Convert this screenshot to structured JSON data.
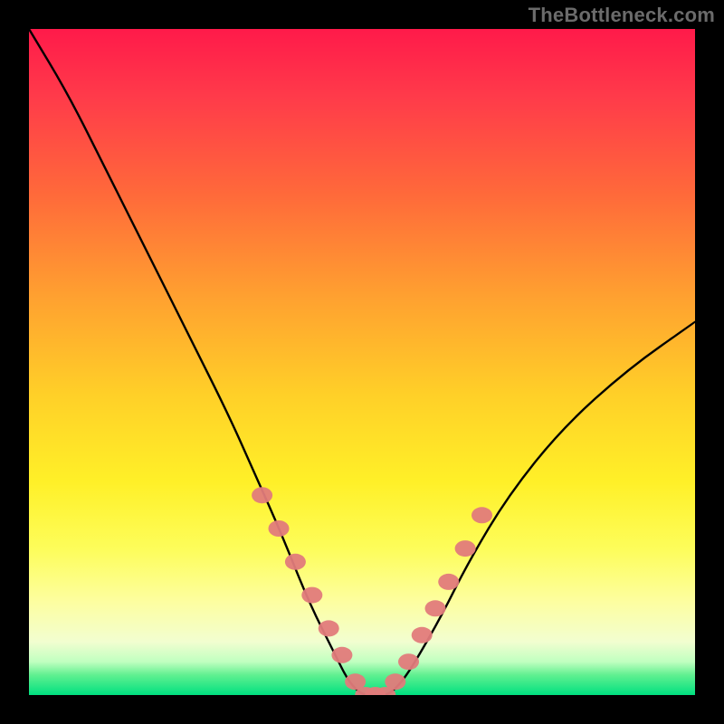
{
  "watermark": "TheBottleneck.com",
  "colors": {
    "frame": "#000000",
    "curve": "#000000",
    "marker_fill": "#e17b7b",
    "marker_stroke": "#b85a5a"
  },
  "chart_data": {
    "type": "line",
    "title": "",
    "xlabel": "",
    "ylabel": "",
    "xlim": [
      0,
      100
    ],
    "ylim": [
      0,
      100
    ],
    "grid": false,
    "legend": false,
    "note": "Axes unlabeled; x approximates configuration index, y approximates bottleneck %. Values are visual estimates from gradient height.",
    "series": [
      {
        "name": "bottleneck-curve",
        "x": [
          0,
          6,
          12,
          18,
          24,
          30,
          34,
          38,
          42,
          46,
          48,
          50,
          52,
          54,
          56,
          58,
          62,
          66,
          72,
          80,
          90,
          100
        ],
        "y": [
          100,
          90,
          78,
          66,
          54,
          42,
          33,
          24,
          14,
          6,
          2,
          0,
          0,
          0,
          2,
          5,
          12,
          20,
          30,
          40,
          49,
          56
        ]
      }
    ],
    "markers": {
      "name": "highlighted-points",
      "x": [
        35,
        37.5,
        40,
        42.5,
        45,
        47,
        49,
        50.5,
        52,
        53.5,
        55,
        57,
        59,
        61,
        63,
        65.5,
        68
      ],
      "y": [
        30,
        25,
        20,
        15,
        10,
        6,
        2,
        0,
        0,
        0,
        2,
        5,
        9,
        13,
        17,
        22,
        27
      ]
    }
  }
}
